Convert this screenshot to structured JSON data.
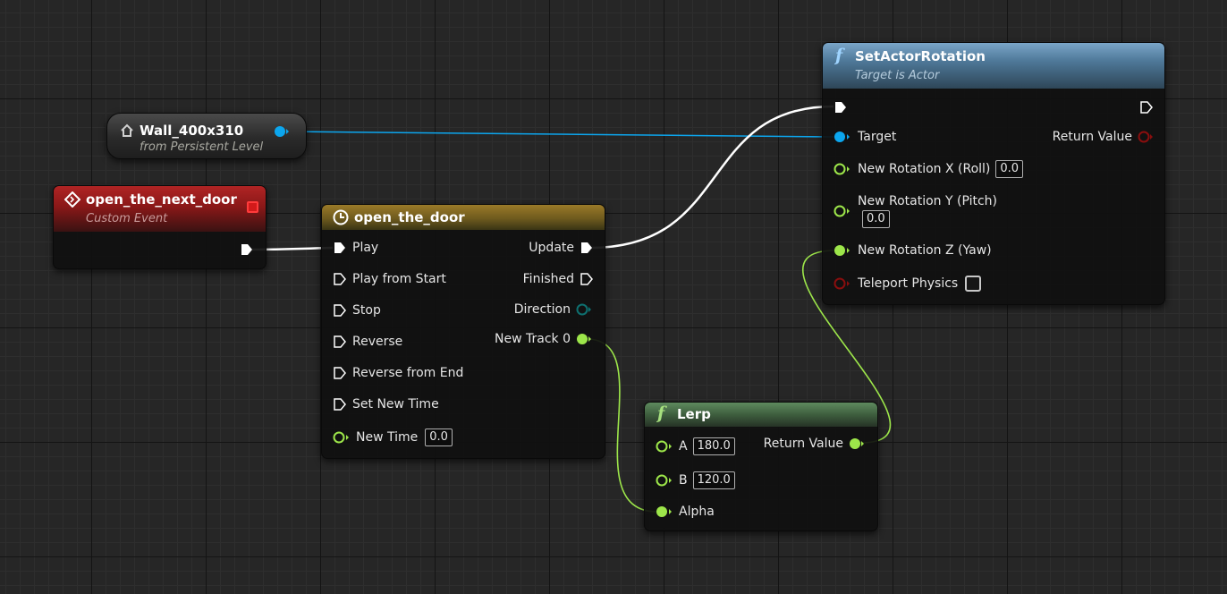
{
  "wall_node": {
    "title": "Wall_400x310",
    "subtitle": "from Persistent Level",
    "icon": "house-icon"
  },
  "event_node": {
    "title": "open_the_next_door",
    "subtitle": "Custom Event",
    "icon": "event-diamond-icon"
  },
  "timeline_node": {
    "title": "open_the_door",
    "icon": "clock-icon",
    "inputs": [
      "Play",
      "Play from Start",
      "Stop",
      "Reverse",
      "Reverse from End",
      "Set New Time"
    ],
    "new_time_label": "New Time",
    "new_time_value": "0.0",
    "outputs": [
      "Update",
      "Finished",
      "Direction",
      "New Track 0"
    ]
  },
  "set_actor_rotation_node": {
    "title": "SetActorRotation",
    "subtitle": "Target is Actor",
    "icon": "function-icon",
    "target_label": "Target",
    "return_label": "Return Value",
    "roll_label": "New Rotation X (Roll)",
    "roll_value": "0.0",
    "pitch_label": "New Rotation Y (Pitch)",
    "pitch_value": "0.0",
    "yaw_label": "New Rotation Z (Yaw)",
    "teleport_label": "Teleport Physics"
  },
  "lerp_node": {
    "title": "Lerp",
    "icon": "function-icon",
    "a_label": "A",
    "a_value": "180.0",
    "b_label": "B",
    "b_value": "120.0",
    "alpha_label": "Alpha",
    "return_label": "Return Value"
  },
  "colors": {
    "exec": "#ffffff",
    "object_pin": "#0ca6ee",
    "float_pin": "#9de64a",
    "bool_pin": "#8a0e0e",
    "enum_pin": "#0e6c6c",
    "event_header": "#8a1a1a",
    "timeline_header": "#7a6320",
    "function_header": "#3a5f7d",
    "lerp_header": "#3b5a3b"
  }
}
